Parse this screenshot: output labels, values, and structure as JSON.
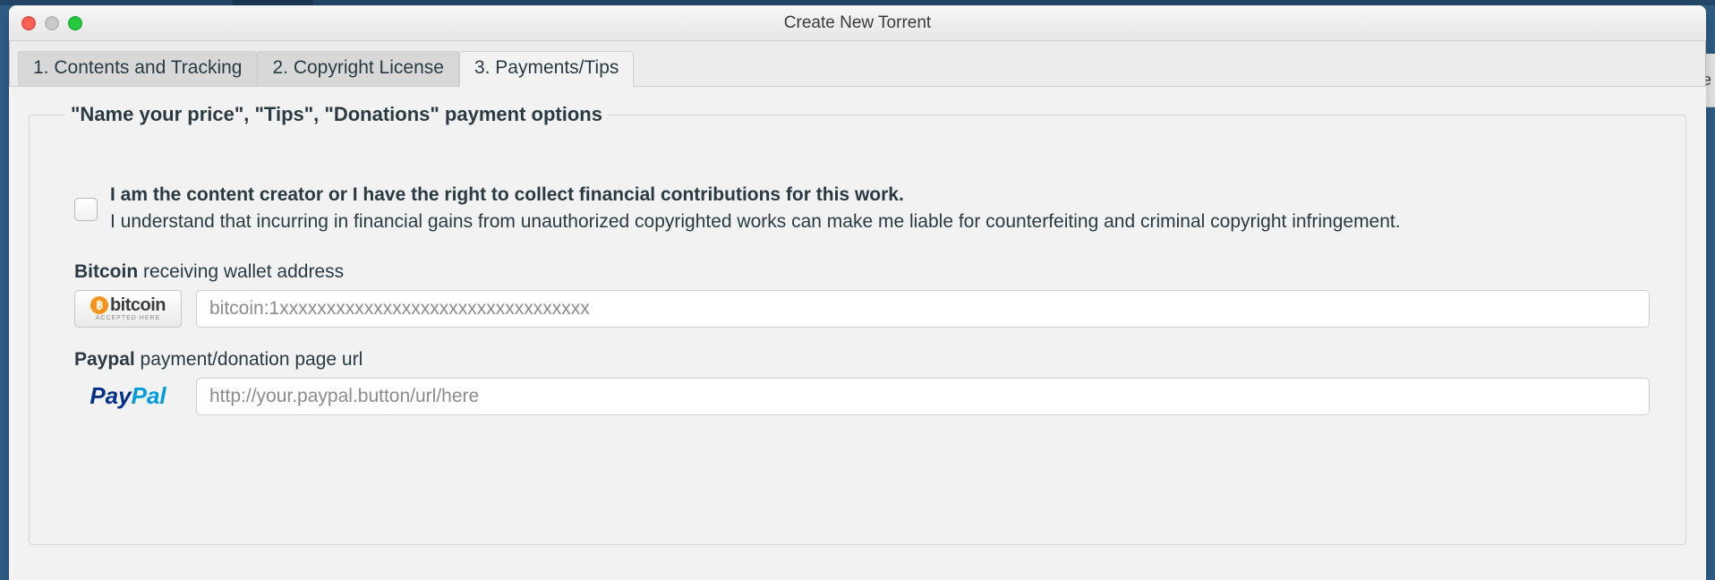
{
  "window": {
    "title": "Create New Torrent"
  },
  "tabs": {
    "items": [
      {
        "label": "1. Contents and Tracking",
        "active": false
      },
      {
        "label": "2. Copyright License",
        "active": false
      },
      {
        "label": "3. Payments/Tips",
        "active": true
      }
    ]
  },
  "payments": {
    "group_title": "\"Name your price\", \"Tips\", \"Donations\" payment options",
    "consent": {
      "checked": false,
      "bold_line": "I am the content creator or I have the right to collect financial contributions for this work.",
      "normal_line": "I understand that incurring in financial gains from unauthorized copyrighted works can make me liable for counterfeiting and criminal copyright infringement."
    },
    "bitcoin": {
      "label_bold": "Bitcoin",
      "label_rest": " receiving wallet address",
      "badge_text": "bitcoin",
      "badge_sub": "ACCEPTED HERE",
      "value": "",
      "placeholder": "bitcoin:1xxxxxxxxxxxxxxxxxxxxxxxxxxxxxxxxx"
    },
    "paypal": {
      "label_bold": "Paypal",
      "label_rest": " payment/donation page url",
      "badge_dark": "Pay",
      "badge_light": "Pal",
      "value": "",
      "placeholder": "http://your.paypal.button/url/here"
    }
  },
  "background": {
    "peek_text": "ate"
  }
}
